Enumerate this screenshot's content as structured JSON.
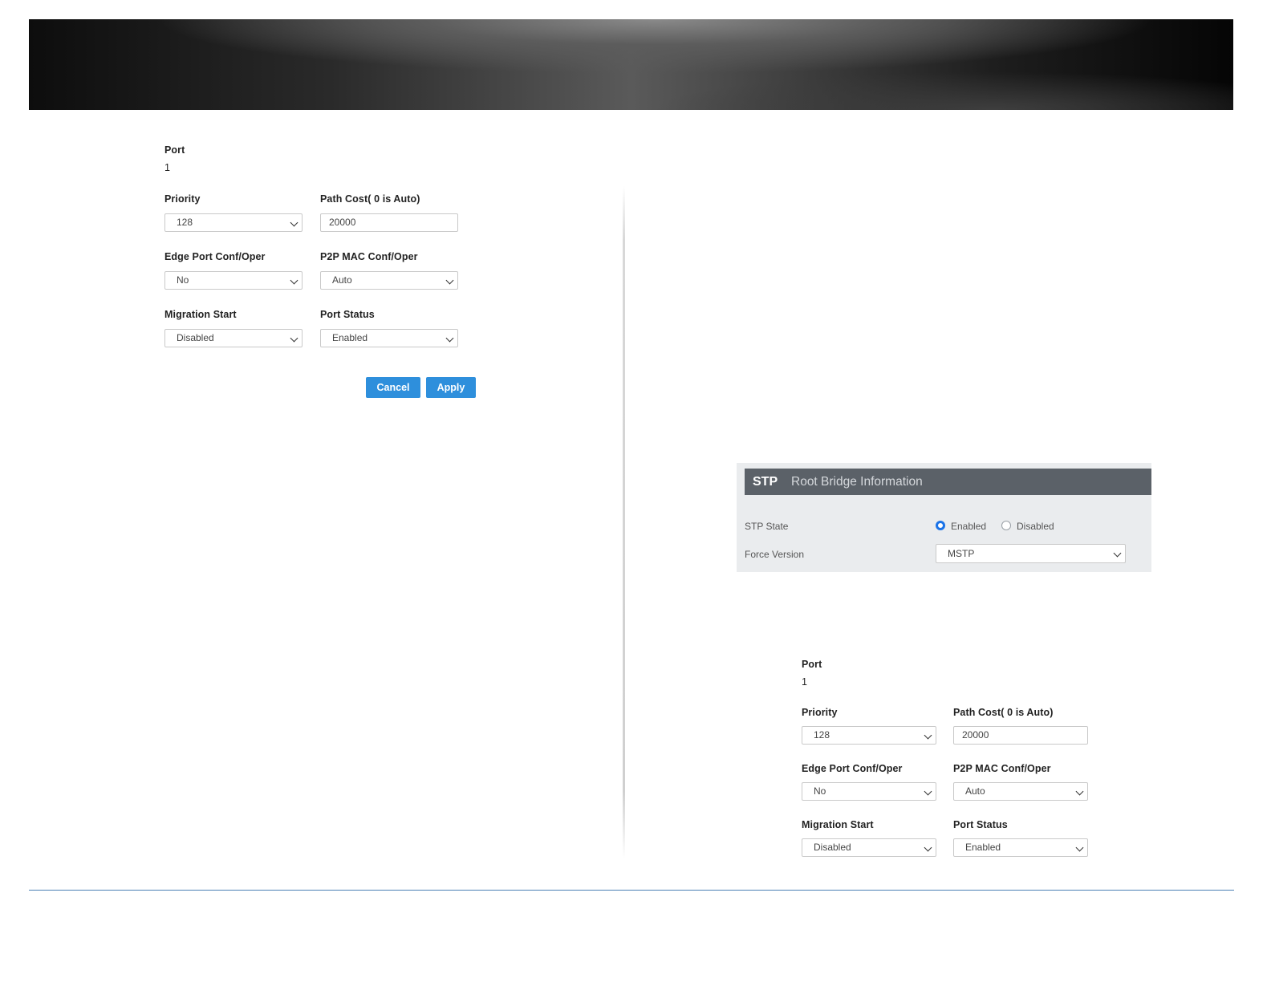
{
  "left_form": {
    "port_label": "Port",
    "port_value": "1",
    "priority_label": "Priority",
    "priority_value": "128",
    "path_cost_label": "Path Cost( 0 is Auto)",
    "path_cost_value": "20000",
    "edge_port_label": "Edge Port Conf/Oper",
    "edge_port_value": "No",
    "p2p_mac_label": "P2P MAC Conf/Oper",
    "p2p_mac_value": "Auto",
    "migration_label": "Migration Start",
    "migration_value": "Disabled",
    "port_status_label": "Port Status",
    "port_status_value": "Enabled",
    "cancel_label": "Cancel",
    "apply_label": "Apply"
  },
  "stp_panel": {
    "title": "STP",
    "subtitle": "Root Bridge Information",
    "state_label": "STP State",
    "enabled_label": "Enabled",
    "disabled_label": "Disabled",
    "state_selected": "Enabled",
    "force_version_label": "Force Version",
    "force_version_value": "MSTP"
  },
  "right_form": {
    "port_label": "Port",
    "port_value": "1",
    "priority_label": "Priority",
    "priority_value": "128",
    "path_cost_label": "Path Cost( 0 is Auto)",
    "path_cost_value": "20000",
    "edge_port_label": "Edge Port Conf/Oper",
    "edge_port_value": "No",
    "p2p_mac_label": "P2P MAC Conf/Oper",
    "p2p_mac_value": "Auto",
    "migration_label": "Migration Start",
    "migration_value": "Disabled",
    "port_status_label": "Port Status",
    "port_status_value": "Enabled"
  },
  "colors": {
    "button_blue": "#2e8fdc",
    "panel_header": "#5b6168",
    "radio_selected": "#1a73e8",
    "footer_rule": "#4a7fb5"
  }
}
